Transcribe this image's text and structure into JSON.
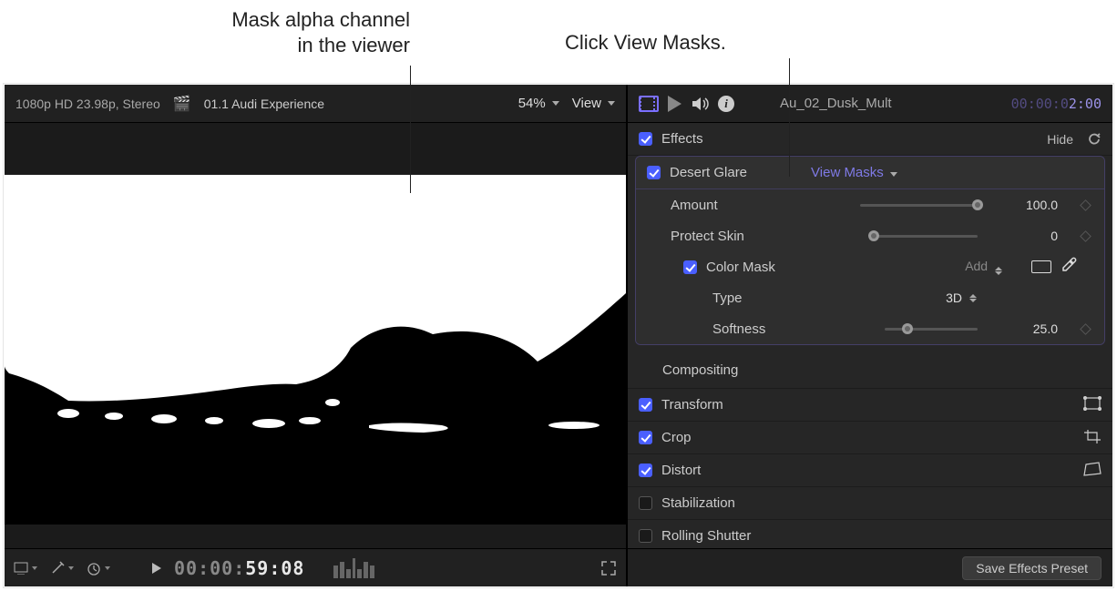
{
  "annotations": {
    "left_line1": "Mask alpha channel",
    "left_line2": "in the viewer",
    "right": "Click View Masks."
  },
  "viewer": {
    "format": "1080p HD 23.98p, Stereo",
    "clip_title": "01.1 Audi Experience",
    "zoom": "54%",
    "view_label": "View",
    "timecode_dim": "00:00:",
    "timecode_bright": "59:08"
  },
  "inspector": {
    "clip_name": "Au_02_Dusk_Mult",
    "clip_tc_dim": "00:00:0",
    "clip_tc_bright": "2:00",
    "effects_header": "Effects",
    "hide_label": "Hide",
    "desert_glare": {
      "name": "Desert Glare",
      "view_masks": "View Masks",
      "amount_label": "Amount",
      "amount_value": "100.0",
      "protect_skin_label": "Protect Skin",
      "protect_skin_value": "0",
      "color_mask_label": "Color Mask",
      "add_label": "Add",
      "type_label": "Type",
      "type_value": "3D",
      "softness_label": "Softness",
      "softness_value": "25.0"
    },
    "compositing": "Compositing",
    "transform": "Transform",
    "crop": "Crop",
    "distort": "Distort",
    "stabilization": "Stabilization",
    "rolling_shutter": "Rolling Shutter",
    "save_preset": "Save Effects Preset"
  }
}
